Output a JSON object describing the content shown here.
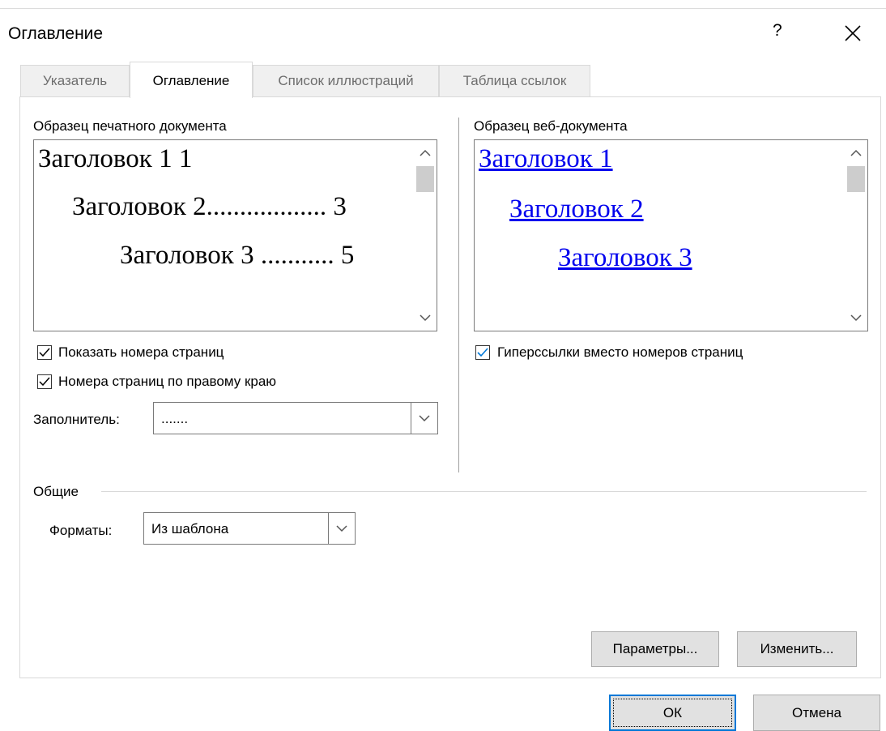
{
  "dialog": {
    "title": "Оглавление",
    "help": "?",
    "close_icon": "close-icon"
  },
  "tabs": [
    {
      "label": "Указатель",
      "active": false
    },
    {
      "label": "Оглавление",
      "active": true
    },
    {
      "label": "Список иллюстраций",
      "active": false
    },
    {
      "label": "Таблица ссылок",
      "active": false
    }
  ],
  "print_preview": {
    "label": "Образец печатного документа",
    "lines": [
      "Заголовок 1 1",
      "Заголовок 2.................. 3",
      "Заголовок 3 ........... 5"
    ]
  },
  "web_preview": {
    "label": "Образец веб-документа",
    "links": [
      "Заголовок 1",
      "Заголовок 2",
      "Заголовок 3"
    ]
  },
  "options": {
    "show_page_numbers": {
      "label": "Показать номера страниц",
      "checked": true
    },
    "right_align": {
      "label": "Номера страниц по правому краю",
      "checked": true
    },
    "tab_leader": {
      "label": "Заполнитель:",
      "value": "......."
    },
    "hyperlinks": {
      "label": "Гиперссылки вместо номеров страниц",
      "checked": true
    }
  },
  "general": {
    "label": "Общие",
    "formats_label": "Форматы:",
    "formats_value": "Из шаблона"
  },
  "buttons": {
    "options": "Параметры...",
    "modify": "Изменить...",
    "ok": "ОК",
    "cancel": "Отмена"
  },
  "colors": {
    "accent": "#0078d7",
    "link": "#0000ee"
  }
}
